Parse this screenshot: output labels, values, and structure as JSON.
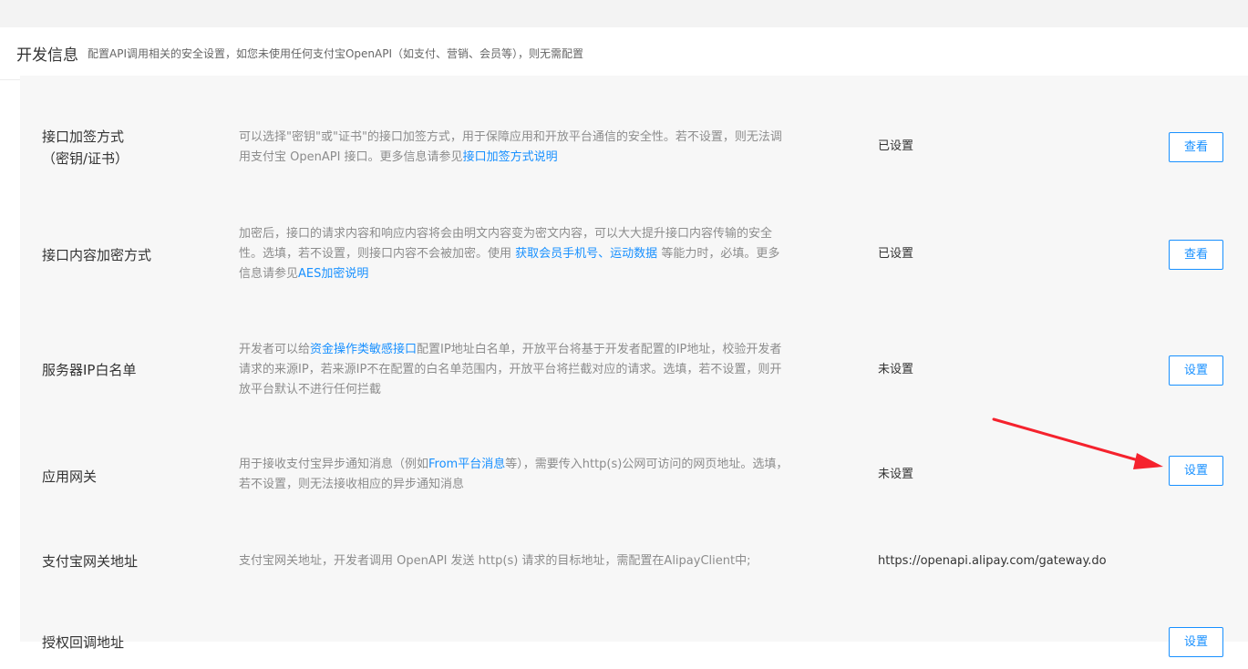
{
  "header": {
    "title": "开发信息",
    "description": "配置API调用相关的安全设置，如您未使用任何支付宝OpenAPI（如支付、营销、会员等），则无需配置"
  },
  "rows": [
    {
      "label_line1": "接口加签方式",
      "label_line2": "（密钥/证书）",
      "desc_line1": "可以选择\"密钥\"或\"证书\"的接口加签方式，用于保障应用和开放平台通信的安全性。若不设置，则无法调",
      "desc_line2_text": "用支付宝 OpenAPI 接口。更多信息请参见",
      "desc_link": "接口加签方式说明",
      "status": "已设置",
      "button": "查看"
    },
    {
      "label": "接口内容加密方式",
      "desc_line1": "加密后，接口的请求内容和响应内容将会由明文内容变为密文内容，可以大大提升接口内容传输的安全",
      "desc_line2_a": "性。选填，若不设置，则接口内容不会被加密。使用 ",
      "desc_link1": "获取会员手机号",
      "desc_sep": "、",
      "desc_link2": "运动数据",
      "desc_line2_b": " 等能力时，必填。更多",
      "desc_line3_text": "信息请参见",
      "desc_link3": "AES加密说明",
      "status": "已设置",
      "button": "查看"
    },
    {
      "label": "服务器IP白名单",
      "desc_line1_a": "开发者可以给",
      "desc_link": "资金操作类敏感接口",
      "desc_line1_b": "配置IP地址白名单，开放平台将基于开发者配置的IP地址，校验开发者",
      "desc_line2": "请求的来源IP，若来源IP不在配置的白名单范围内，开放平台将拦截对应的请求。选填，若不设置，则开",
      "desc_line3": "放平台默认不进行任何拦截",
      "status": "未设置",
      "button": "设置"
    },
    {
      "label": "应用网关",
      "desc_line1_a": "用于接收支付宝异步通知消息（例如",
      "desc_link": "From平台消息",
      "desc_line1_b": "等），需要传入http(s)公网可访问的网页地址。选填，",
      "desc_line2": "若不设置，则无法接收相应的异步通知消息",
      "status": "未设置",
      "button": "设置"
    },
    {
      "label": "支付宝网关地址",
      "desc": "支付宝网关地址，开发者调用 OpenAPI 发送 http(s) 请求的目标地址，需配置在AlipayClient中;",
      "value": "https://openapi.alipay.com/gateway.do"
    },
    {
      "label": "授权回调地址",
      "button": "设置"
    }
  ],
  "colors": {
    "link": "#1890ff",
    "arrow": "#f5222d"
  }
}
